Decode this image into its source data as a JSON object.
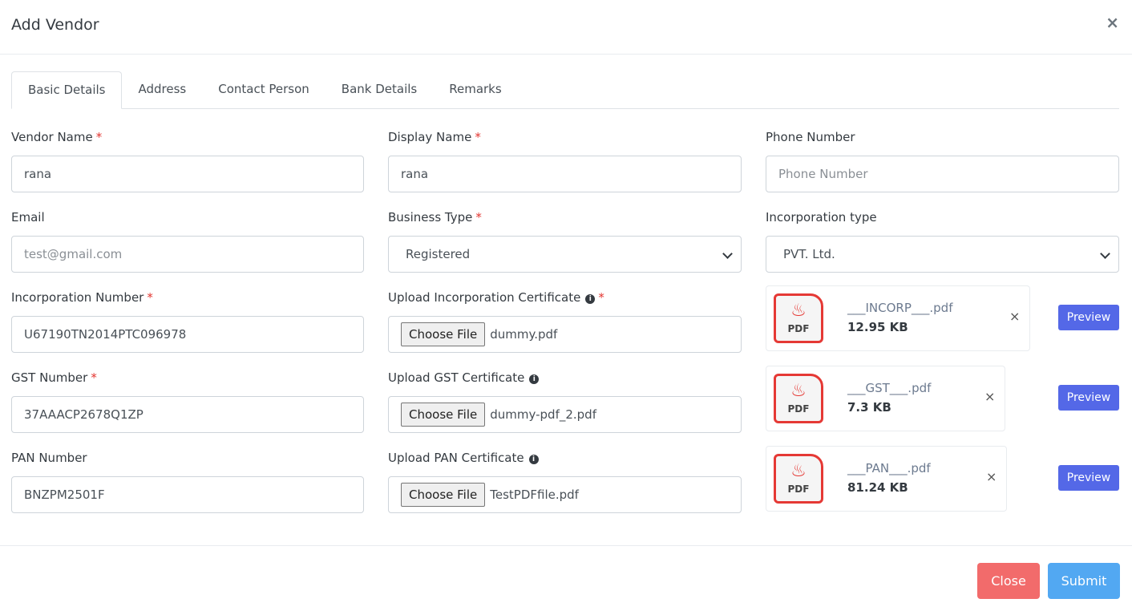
{
  "modal": {
    "title": "Add Vendor",
    "close_icon": "×"
  },
  "tabs": [
    "Basic Details",
    "Address",
    "Contact Person",
    "Bank Details",
    "Remarks"
  ],
  "fields": {
    "vendor_name": {
      "label": "Vendor Name",
      "value": "rana"
    },
    "display_name": {
      "label": "Display Name",
      "value": "rana"
    },
    "phone": {
      "label": "Phone Number",
      "placeholder": "Phone Number"
    },
    "email": {
      "label": "Email",
      "placeholder": "test@gmail.com"
    },
    "business_type": {
      "label": "Business Type",
      "value": "Registered"
    },
    "incorporation_type": {
      "label": "Incorporation type",
      "value": "PVT. Ltd."
    },
    "incorporation_number": {
      "label": "Incorporation Number",
      "value": "U67190TN2014PTC096978"
    },
    "incorp_cert": {
      "label": "Upload Incorporation Certificate",
      "button": "Choose File",
      "file": "dummy.pdf"
    },
    "gst_number": {
      "label": "GST Number",
      "value": "37AAACP2678Q1ZP"
    },
    "gst_cert": {
      "label": "Upload GST Certificate",
      "button": "Choose File",
      "file": "dummy-pdf_2.pdf"
    },
    "pan_number": {
      "label": "PAN Number",
      "value": "BNZPM2501F"
    },
    "pan_cert": {
      "label": "Upload PAN Certificate",
      "button": "Choose File",
      "file": "TestPDFfile.pdf"
    }
  },
  "required_mark": "*",
  "uploads": [
    {
      "name": "___INCORP___.pdf",
      "size": "12.95 KB",
      "icon_text": "PDF",
      "preview": "Preview"
    },
    {
      "name": "___GST___.pdf",
      "size": "7.3 KB",
      "icon_text": "PDF",
      "preview": "Preview"
    },
    {
      "name": "___PAN___.pdf",
      "size": "81.24 KB",
      "icon_text": "PDF",
      "preview": "Preview"
    }
  ],
  "footer": {
    "close": "Close",
    "submit": "Submit"
  },
  "colors": {
    "preview": "#5468e7",
    "close": "#f26b6b",
    "submit": "#52a8f2",
    "required": "#e3342f"
  }
}
